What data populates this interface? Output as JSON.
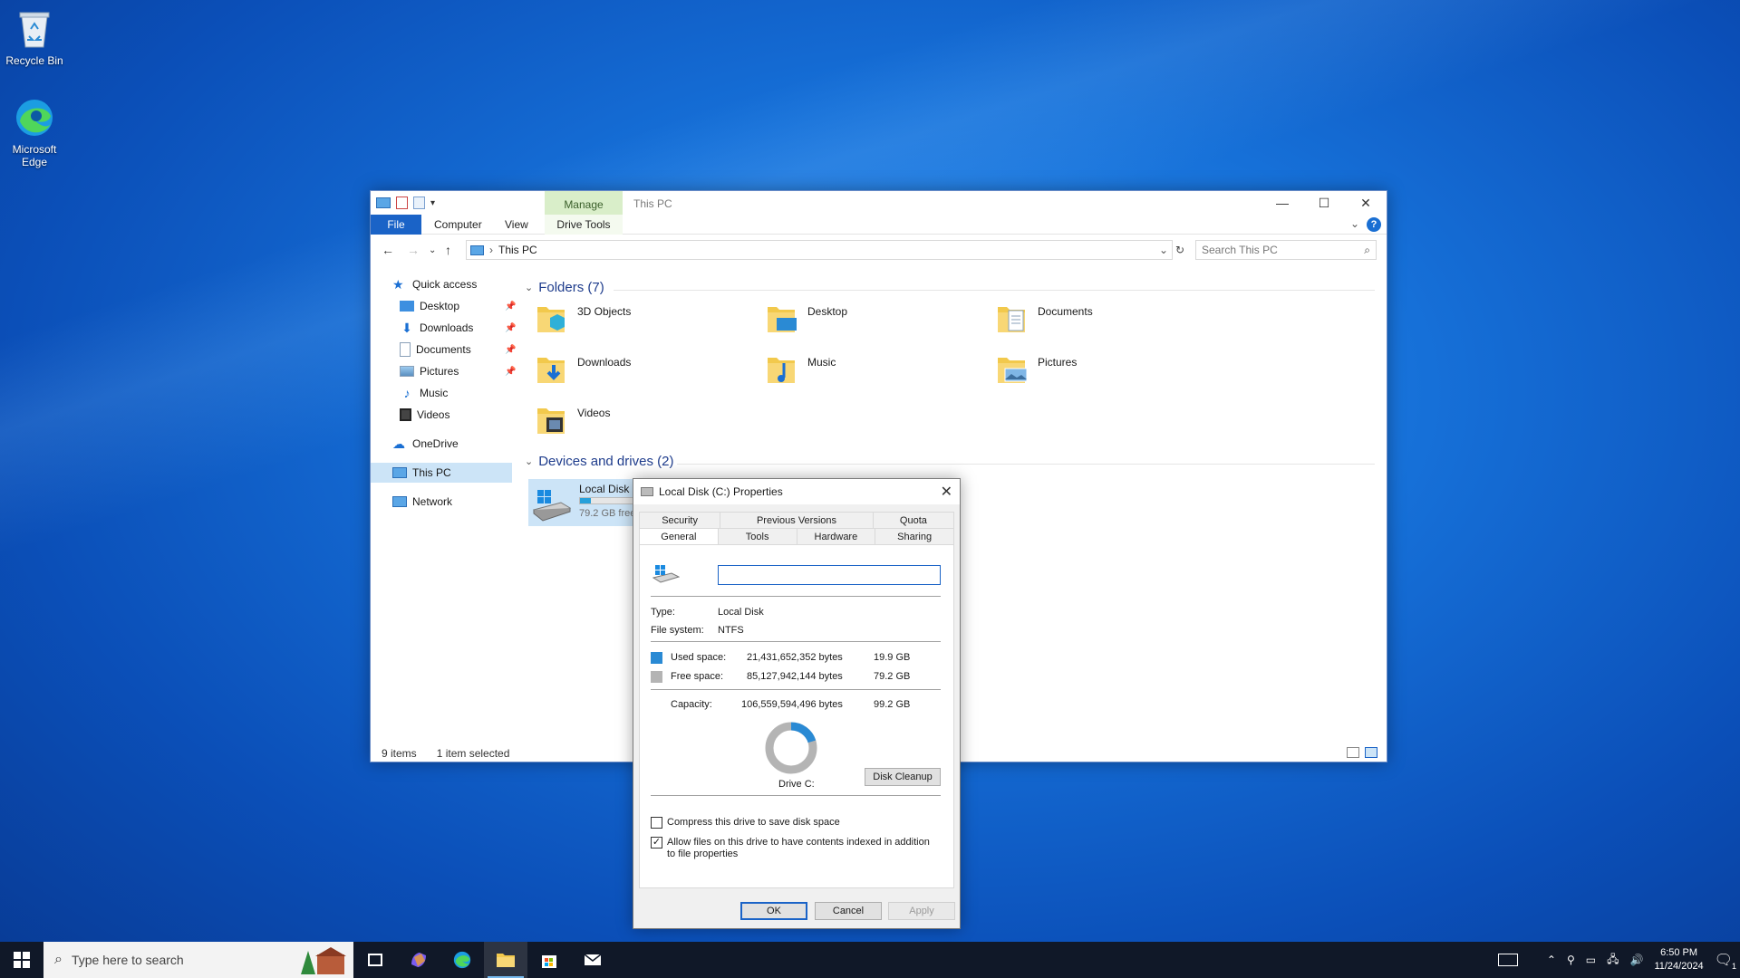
{
  "desktop": {
    "icons": [
      {
        "label": "Recycle Bin"
      },
      {
        "label": "Microsoft Edge"
      }
    ]
  },
  "explorer": {
    "manage_tab": "Manage",
    "title": "This PC",
    "ribbon": {
      "file": "File",
      "computer": "Computer",
      "view": "View",
      "drive_tools": "Drive Tools"
    },
    "address": "This PC",
    "search_placeholder": "Search This PC",
    "nav": {
      "quick_access": "Quick access",
      "items": [
        "Desktop",
        "Downloads",
        "Documents",
        "Pictures",
        "Music",
        "Videos"
      ],
      "onedrive": "OneDrive",
      "this_pc": "This PC",
      "network": "Network"
    },
    "folders_header": "Folders (7)",
    "folders": [
      "3D Objects",
      "Desktop",
      "Documents",
      "Downloads",
      "Music",
      "Pictures",
      "Videos"
    ],
    "drives_header": "Devices and drives (2)",
    "drive": {
      "name": "Local Disk (",
      "free": "79.2 GB free"
    },
    "status": {
      "items": "9 items",
      "selected": "1 item selected"
    }
  },
  "dialog": {
    "title": "Local Disk (C:) Properties",
    "tabs_top": [
      "Security",
      "Previous Versions",
      "Quota"
    ],
    "tabs_bottom": [
      "General",
      "Tools",
      "Hardware",
      "Sharing"
    ],
    "type_label": "Type:",
    "type_value": "Local Disk",
    "fs_label": "File system:",
    "fs_value": "NTFS",
    "used_label": "Used space:",
    "used_bytes": "21,431,652,352 bytes",
    "used_gb": "19.9 GB",
    "free_label": "Free space:",
    "free_bytes": "85,127,942,144 bytes",
    "free_gb": "79.2 GB",
    "capacity_label": "Capacity:",
    "capacity_bytes": "106,559,594,496 bytes",
    "capacity_gb": "99.2 GB",
    "used_fraction": 0.201,
    "drive_label": "Drive C:",
    "cleanup": "Disk Cleanup",
    "compress": "Compress this drive to save disk space",
    "index": "Allow files on this drive to have contents indexed in addition to file properties",
    "ok": "OK",
    "cancel": "Cancel",
    "apply": "Apply",
    "colors": {
      "used": "#2a8ad4",
      "free": "#b4b4b4"
    }
  },
  "taskbar": {
    "search_placeholder": "Type here to search",
    "time": "6:50 PM",
    "date": "11/24/2024",
    "notification_count": "1"
  }
}
